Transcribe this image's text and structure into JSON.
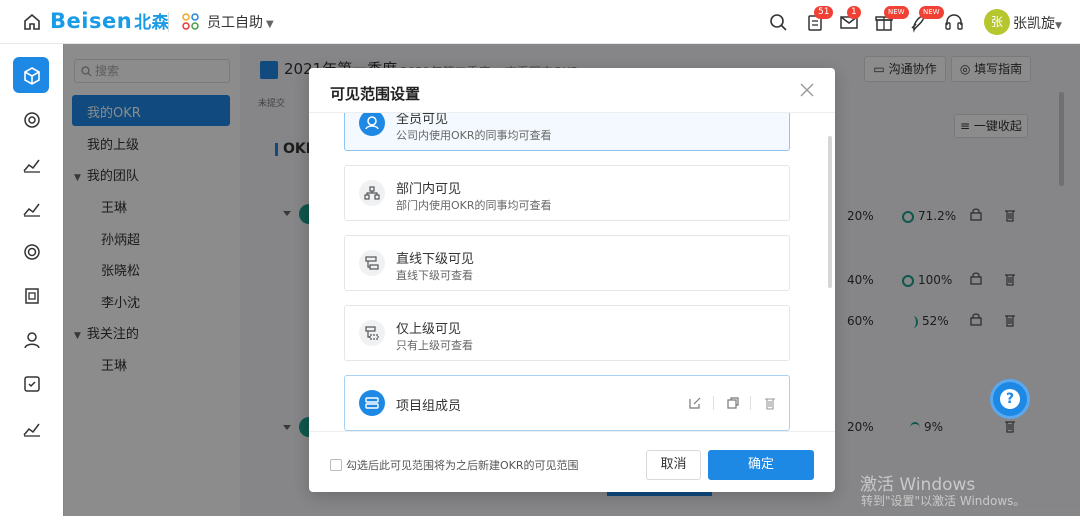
{
  "topbar": {
    "logo_en": "Beisen",
    "logo_cn": "北森",
    "app_name": "员工自助",
    "badges": {
      "tasks": "51",
      "mail": "1",
      "new1": "NEW",
      "new2": "NEW"
    },
    "avatar_char": "张",
    "user_name": "张凯旋"
  },
  "sidebar": {
    "search_placeholder": "搜索",
    "items": [
      "我的OKR",
      "我的上级",
      "我的团队",
      "王琳",
      "孙炳超",
      "张晓松",
      "李小沈",
      "我关注的",
      "王琳"
    ]
  },
  "main": {
    "title": "2021年第一季度",
    "subtitle": "2021年第二季度",
    "history": "查看历史OKR",
    "status": "未提交",
    "okr_header": "OKR",
    "collab_btn": "沟通协作",
    "guide_btn": "填写指南",
    "collapse_btn": "一键收起",
    "rows": [
      {
        "weight": "20%",
        "progress": "71.2%"
      },
      {
        "weight": "40%",
        "progress": "100%"
      },
      {
        "weight": "60%",
        "progress": "52%"
      },
      {
        "weight": "20%",
        "progress": "9%"
      }
    ]
  },
  "modal": {
    "title": "可见范围设置",
    "options": [
      {
        "title": "全员可见",
        "desc": "公司内使用OKR的同事均可查看"
      },
      {
        "title": "部门内可见",
        "desc": "部门内使用OKR的同事均可查看"
      },
      {
        "title": "直线下级可见",
        "desc": "直线下级可查看"
      },
      {
        "title": "仅上级可见",
        "desc": "只有上级可查看"
      },
      {
        "title": "项目组成员",
        "desc": ""
      }
    ],
    "checkbox_label": "勾选后此可见范围将为之后新建OKR的可见范围",
    "cancel": "取消",
    "confirm": "确定"
  },
  "watermark": {
    "line1": "激活 Windows",
    "line2": "转到\"设置\"以激活 Windows。"
  }
}
